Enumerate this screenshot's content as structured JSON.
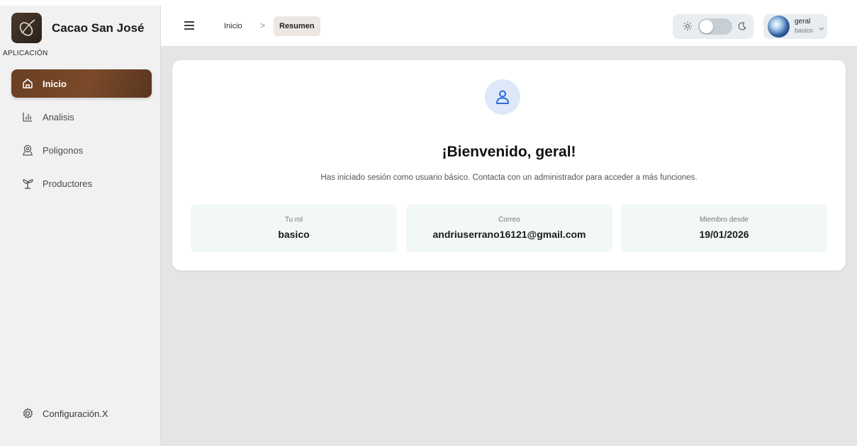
{
  "brand": {
    "name": "Cacao San José"
  },
  "sidebar": {
    "section_label": "APLICACIÓN",
    "items": [
      {
        "label": "Inicio",
        "icon": "home-icon",
        "active": true
      },
      {
        "label": "Analisis",
        "icon": "bar-chart-icon",
        "active": false
      },
      {
        "label": "Poligonos",
        "icon": "map-pin-icon",
        "active": false
      },
      {
        "label": "Productores",
        "icon": "sprout-icon",
        "active": false
      }
    ],
    "settings_label": "Configuración.X"
  },
  "header": {
    "breadcrumb": {
      "home": "Inicio",
      "separator": ">",
      "current": "Resumen"
    },
    "user": {
      "name": "geral",
      "role": "basico"
    }
  },
  "main": {
    "title": "¡Bienvenido, geral!",
    "subtitle": "Has iniciado sesión como usuario básico. Contacta con un administrador para acceder a más funciones.",
    "info": [
      {
        "label": "Tu rol",
        "value": "basico"
      },
      {
        "label": "Correo",
        "value": "andriuserrano16121@gmail.com"
      },
      {
        "label": "Miembro desde",
        "value": "19/01/2026"
      }
    ]
  },
  "colors": {
    "active_nav": "#6b3f22",
    "accent_blue": "#3b6fd8",
    "background": "#e5e5e5"
  }
}
